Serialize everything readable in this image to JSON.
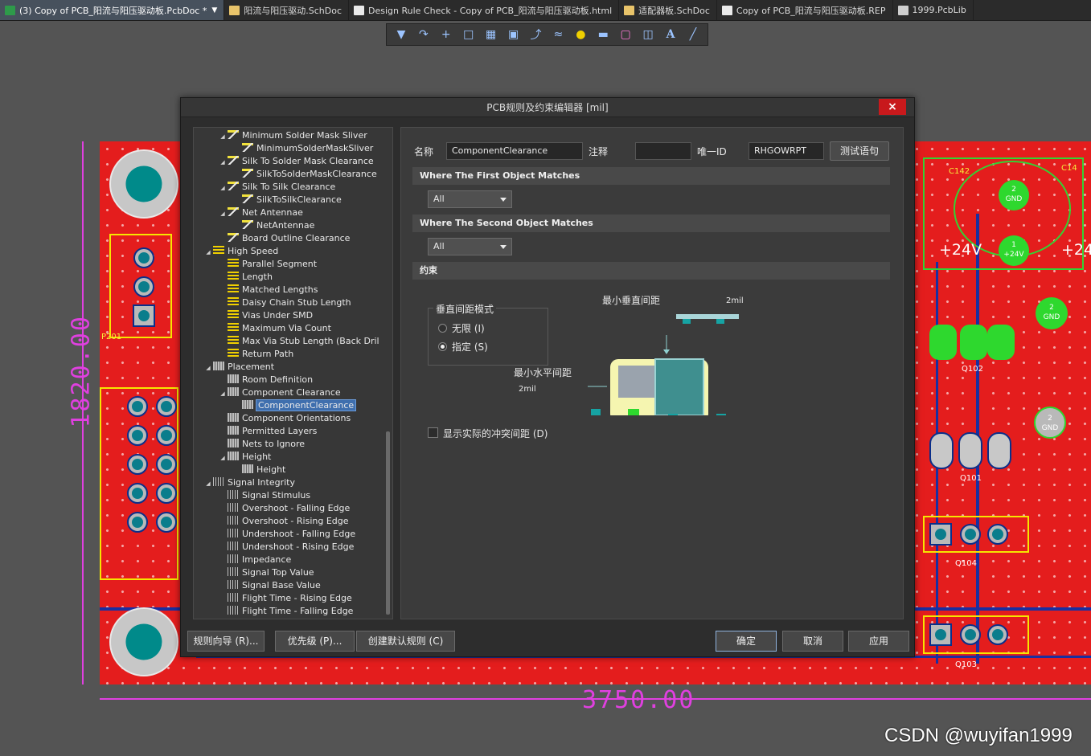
{
  "tabs": [
    {
      "label": "(3) Copy of PCB_阳流与阳压驱动板.PcbDoc *",
      "color": "#2e9a4a",
      "active": true
    },
    {
      "label": "阳流与阳压驱动.SchDoc",
      "color": "#e9c46a"
    },
    {
      "label": "Design Rule Check - Copy of PCB_阳流与阳压驱动板.html",
      "color": "#eaeaea"
    },
    {
      "label": "适配器板.SchDoc",
      "color": "#e9c46a"
    },
    {
      "label": "Copy of PCB_阳流与阳压驱动板.REP",
      "color": "#eaeaea"
    },
    {
      "label": "1999.PcbLib",
      "color": "#cfcfcf"
    }
  ],
  "toolbar_icons": [
    "filter-icon",
    "route-icon",
    "cross-icon",
    "select-rect-icon",
    "chart-icon",
    "chip-icon",
    "interactive-route-icon",
    "diff-route-icon",
    "pin-icon",
    "fill-icon",
    "graph-icon",
    "dimension-icon",
    "text-icon",
    "line-icon"
  ],
  "pcb": {
    "dim_vertical": "1820.00",
    "dim_horizontal": "3750.00",
    "labels": {
      "c142": "C142",
      "c14": "C14",
      "gnd": "GND",
      "v24a": "+24V",
      "v24b": "+24V",
      "v24small": "+24V",
      "q102": "Q102",
      "q101": "Q101",
      "q104": "Q104",
      "q103": "Q103",
      "p201": "P201",
      "one": "1",
      "two": "2"
    }
  },
  "dialog": {
    "title": "PCB规则及约束编辑器 [mil]",
    "close": "×",
    "tree": [
      {
        "label": "Minimum Solder Mask Sliver",
        "level": 2,
        "icon": "rule",
        "arrow": "▲"
      },
      {
        "label": "MinimumSolderMaskSliver",
        "level": 3,
        "icon": "rule"
      },
      {
        "label": "Silk To Solder Mask Clearance",
        "level": 2,
        "icon": "rule",
        "arrow": "▲"
      },
      {
        "label": "SilkToSolderMaskClearance",
        "level": 3,
        "icon": "rule"
      },
      {
        "label": "Silk To Silk Clearance",
        "level": 2,
        "icon": "rule",
        "arrow": "▲"
      },
      {
        "label": "SilkToSilkClearance",
        "level": 3,
        "icon": "rule"
      },
      {
        "label": "Net Antennae",
        "level": 2,
        "icon": "rule",
        "arrow": "▲"
      },
      {
        "label": "NetAntennae",
        "level": 3,
        "icon": "rule"
      },
      {
        "label": "Board Outline Clearance",
        "level": 2,
        "icon": "rule"
      },
      {
        "label": "High Speed",
        "level": 1,
        "icon": "hs",
        "arrow": "▲"
      },
      {
        "label": "Parallel Segment",
        "level": 2,
        "icon": "hs"
      },
      {
        "label": "Length",
        "level": 2,
        "icon": "hs"
      },
      {
        "label": "Matched Lengths",
        "level": 2,
        "icon": "hs"
      },
      {
        "label": "Daisy Chain Stub Length",
        "level": 2,
        "icon": "hs"
      },
      {
        "label": "Vias Under SMD",
        "level": 2,
        "icon": "hs"
      },
      {
        "label": "Maximum Via Count",
        "level": 2,
        "icon": "hs"
      },
      {
        "label": "Max Via Stub Length (Back Dril",
        "level": 2,
        "icon": "hs"
      },
      {
        "label": "Return Path",
        "level": 2,
        "icon": "hs"
      },
      {
        "label": "Placement",
        "level": 1,
        "icon": "pl",
        "arrow": "▲"
      },
      {
        "label": "Room Definition",
        "level": 2,
        "icon": "pl"
      },
      {
        "label": "Component Clearance",
        "level": 2,
        "icon": "pl",
        "arrow": "▲"
      },
      {
        "label": "ComponentClearance",
        "level": 3,
        "icon": "pl",
        "selected": true
      },
      {
        "label": "Component Orientations",
        "level": 2,
        "icon": "pl"
      },
      {
        "label": "Permitted Layers",
        "level": 2,
        "icon": "pl"
      },
      {
        "label": "Nets to Ignore",
        "level": 2,
        "icon": "pl"
      },
      {
        "label": "Height",
        "level": 2,
        "icon": "pl",
        "arrow": "▲"
      },
      {
        "label": "Height",
        "level": 3,
        "icon": "pl"
      },
      {
        "label": "Signal Integrity",
        "level": 1,
        "icon": "si",
        "arrow": "▲"
      },
      {
        "label": "Signal Stimulus",
        "level": 2,
        "icon": "si"
      },
      {
        "label": "Overshoot - Falling Edge",
        "level": 2,
        "icon": "si"
      },
      {
        "label": "Overshoot - Rising Edge",
        "level": 2,
        "icon": "si"
      },
      {
        "label": "Undershoot - Falling Edge",
        "level": 2,
        "icon": "si"
      },
      {
        "label": "Undershoot - Rising Edge",
        "level": 2,
        "icon": "si"
      },
      {
        "label": "Impedance",
        "level": 2,
        "icon": "si"
      },
      {
        "label": "Signal Top Value",
        "level": 2,
        "icon": "si"
      },
      {
        "label": "Signal Base Value",
        "level": 2,
        "icon": "si"
      },
      {
        "label": "Flight Time - Rising Edge",
        "level": 2,
        "icon": "si"
      },
      {
        "label": "Flight Time - Falling Edge",
        "level": 2,
        "icon": "si"
      }
    ],
    "form": {
      "name_label": "名称",
      "name_value": "ComponentClearance",
      "comment_label": "注释",
      "comment_value": "",
      "id_label": "唯一ID",
      "id_value": "RHGOWRPT",
      "test_button": "测试语句",
      "first_match_header": "Where The First Object Matches",
      "first_match_value": "All",
      "second_match_header": "Where The Second Object Matches",
      "second_match_value": "All",
      "constraint_header": "约束",
      "vertical_mode_title": "垂直间距模式",
      "radio_infinite": "无限 (I)",
      "radio_specified": "指定 (S)",
      "selected_mode": "指定 (S)",
      "min_vertical_label": "最小垂直间距",
      "min_vertical_value": "2mil",
      "min_horizontal_label": "最小水平间距",
      "min_horizontal_value": "2mil",
      "show_actual_label": "显示实际的冲突间距 (D)",
      "show_actual_checked": false
    },
    "buttons": {
      "wizard": "规则向导 (R)...",
      "priority": "优先级 (P)...",
      "create_default": "创建默认规则 (C)",
      "ok": "确定",
      "cancel": "取消",
      "apply": "应用"
    }
  },
  "watermark": "CSDN @wuyifan1999"
}
